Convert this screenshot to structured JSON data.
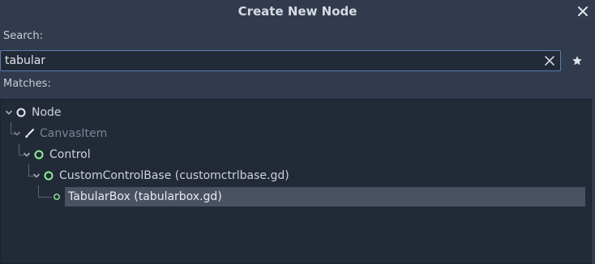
{
  "dialog": {
    "title": "Create New Node"
  },
  "search": {
    "label": "Search:",
    "value": "tabular"
  },
  "matches": {
    "label": "Matches:"
  },
  "tree": [
    {
      "label": "Node",
      "icon": "node-circle-icon",
      "color": "#e0e0e0"
    },
    {
      "label": "CanvasItem",
      "icon": "canvasitem-brush-icon",
      "color": "#e0e0e0"
    },
    {
      "label": "Control",
      "icon": "control-circle-icon",
      "color": "#8eef97"
    },
    {
      "label": "CustomControlBase (customctrlbase.gd)",
      "icon": "control-circle-icon",
      "color": "#8eef97"
    },
    {
      "label": "TabularBox (tabularbox.gd)",
      "icon": "control-circle-icon",
      "color": "#8eef97"
    }
  ],
  "colors": {
    "background": "#323b4d",
    "panel": "#222a38",
    "selection": "#4a5163",
    "focus_border": "#5c7db3"
  }
}
